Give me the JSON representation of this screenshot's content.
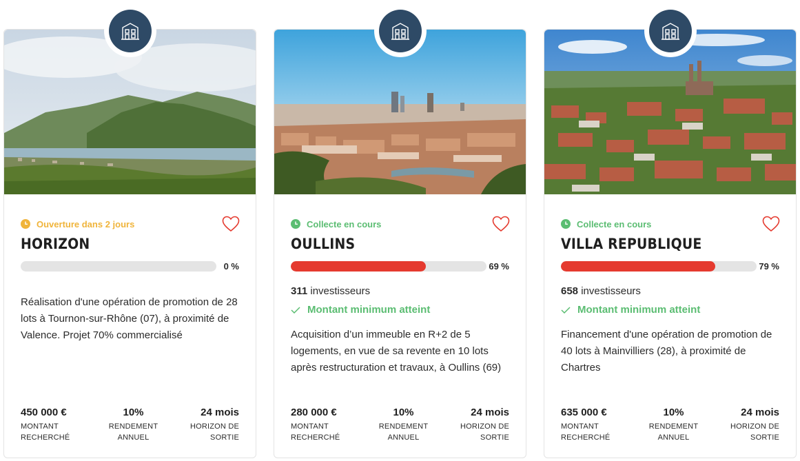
{
  "colors": {
    "accent_red": "#e53a2f",
    "status_green": "#5bbd72",
    "status_orange": "#f0b43a",
    "badge_navy": "#2e4a66"
  },
  "cards": [
    {
      "badge_icon": "building-icon",
      "status": "Ouverture dans 2 jours",
      "status_color": "orange",
      "title": "HORIZON",
      "progress": 0,
      "progress_label": "0 %",
      "description": "Réalisation d'une opération de promotion de 28 lots à Tournon-sur-Rhône (07), à proximité de Valence. Projet 70% commercialisé",
      "stats": [
        {
          "value": "450 000 €",
          "label_1": "MONTANT",
          "label_2": "RECHERCHÉ"
        },
        {
          "value": "10%",
          "label_1": "RENDEMENT",
          "label_2": "ANNUEL"
        },
        {
          "value": "24 mois",
          "label_1": "HORIZON DE",
          "label_2": "SORTIE"
        }
      ]
    },
    {
      "badge_icon": "building-icon",
      "status": "Collecte en cours",
      "status_color": "green",
      "title": "OULLINS",
      "progress": 69,
      "progress_label": "69 %",
      "investors_count": "311",
      "investors_label": "investisseurs",
      "min_reached": "Montant minimum atteint",
      "description": "Acquisition d’un immeuble en R+2 de 5 logements, en vue de sa revente en 10 lots après restructuration et travaux, à Oullins (69)",
      "stats": [
        {
          "value": "280 000 €",
          "label_1": "MONTANT",
          "label_2": "RECHERCHÉ"
        },
        {
          "value": "10%",
          "label_1": "RENDEMENT",
          "label_2": "ANNUEL"
        },
        {
          "value": "24 mois",
          "label_1": "HORIZON DE",
          "label_2": "SORTIE"
        }
      ]
    },
    {
      "badge_icon": "building-icon",
      "status": "Collecte en cours",
      "status_color": "green",
      "title": "VILLA REPUBLIQUE",
      "progress": 79,
      "progress_label": "79 %",
      "investors_count": "658",
      "investors_label": "investisseurs",
      "min_reached": "Montant minimum atteint",
      "description": "Financement d'une opération de promotion de 40 lots à Mainvilliers (28), à proximité de Chartres",
      "stats": [
        {
          "value": "635 000 €",
          "label_1": "MONTANT",
          "label_2": "RECHERCHÉ"
        },
        {
          "value": "10%",
          "label_1": "RENDEMENT",
          "label_2": "ANNUEL"
        },
        {
          "value": "24 mois",
          "label_1": "HORIZON DE",
          "label_2": "SORTIE"
        }
      ]
    }
  ]
}
